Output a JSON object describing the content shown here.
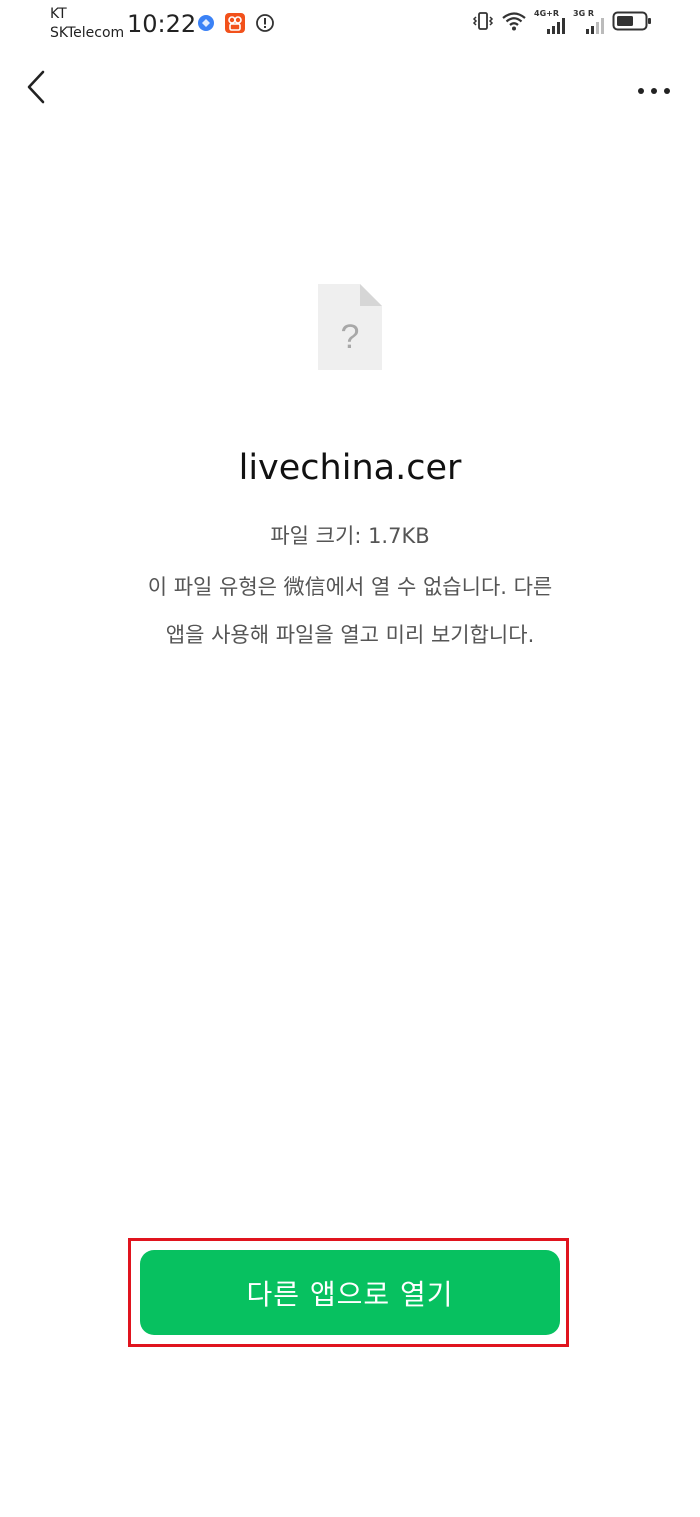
{
  "status_bar": {
    "carrier_line1": "KT",
    "carrier_line2": "SKTelecom",
    "time": "10:22",
    "network1_label": "4G+R",
    "network2_label": "3G R"
  },
  "nav": {
    "back_icon": "chevron-left-icon",
    "more_icon": "more-dots-icon"
  },
  "file": {
    "icon": "unknown-file-icon",
    "icon_glyph": "?",
    "name": "livechina.cer",
    "size_text": "파일 크기: 1.7KB"
  },
  "message": {
    "line1": "이 파일 유형은 微信에서 열 수 없습니다. 다른",
    "line2": "앱을 사용해 파일을 열고 미리 보기합니다."
  },
  "action": {
    "open_with_other_app_label": "다른 앱으로 열기"
  },
  "colors": {
    "button_green": "#07c160",
    "highlight_red": "#e0141e",
    "secondary_text": "#555555"
  }
}
